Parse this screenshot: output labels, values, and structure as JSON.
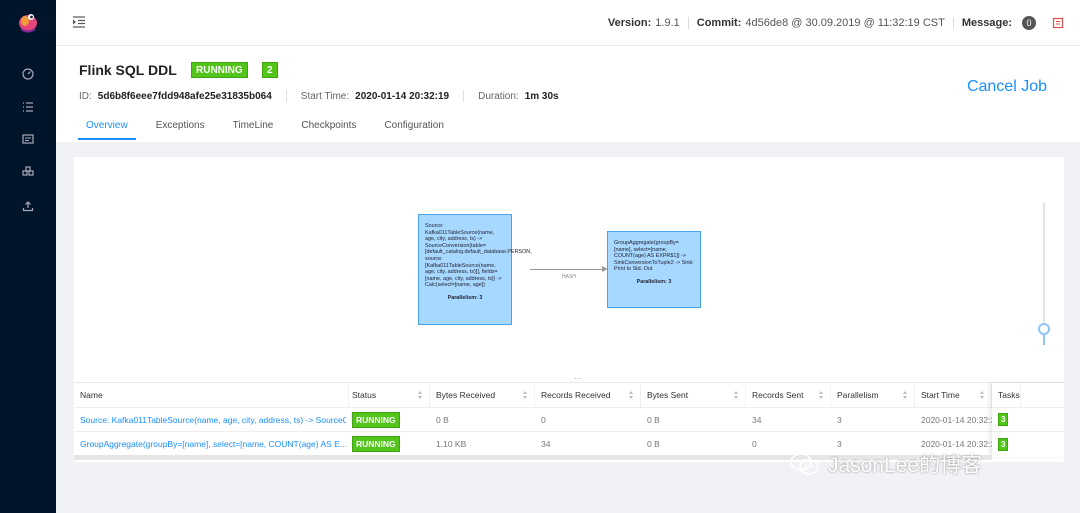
{
  "header": {
    "version_label": "Version:",
    "version_value": "1.9.1",
    "commit_label": "Commit:",
    "commit_value": "4d56de8 @ 30.09.2019 @ 11:32:19 CST",
    "message_label": "Message:",
    "message_count": "0"
  },
  "job": {
    "name": "Flink SQL DDL",
    "status": "RUNNING",
    "task_count": "2",
    "id_label": "ID:",
    "id_value": "5d6b8f6eee7fdd948afe25e31835b064",
    "start_label": "Start Time:",
    "start_value": "2020-01-14 20:32:19",
    "duration_label": "Duration:",
    "duration_value": "1m 30s",
    "cancel_label": "Cancel Job"
  },
  "tabs": [
    "Overview",
    "Exceptions",
    "TimeLine",
    "Checkpoints",
    "Configuration"
  ],
  "graph": {
    "node1_text": "Source: Kafka011TableSource(name, age, city, address, ts) -> SourceConversion(table=[default_catalog.default_database.PERSON, source: [Kafka011TableSource(name, age, city, address, ts)]], fields=[name, age, city, address, ts]) -> Calc(select=[name, age])",
    "node1_parallelism": "Parallelism: 3",
    "node2_text": "GroupAggregate(groupBy=[name], select=[name, COUNT(age) AS EXPR$1]) -> SinkConversionToTuple2 -> Sink: Print to Std. Out",
    "node2_parallelism": "Parallelism: 3",
    "edge_label": "HASH"
  },
  "table": {
    "columns": [
      "Name",
      "Status",
      "Bytes Received",
      "Records Received",
      "Bytes Sent",
      "Records Sent",
      "Parallelism",
      "Start Time",
      "Tasks"
    ],
    "rows": [
      {
        "name": "Source: Kafka011TableSource(name, age, city, address, ts) -> SourceC...",
        "status": "RUNNING",
        "bytes_received": "0 B",
        "records_received": "0",
        "bytes_sent": "0 B",
        "records_sent": "34",
        "parallelism": "3",
        "start_time": "2020-01-14 20:32:3",
        "tasks": "3"
      },
      {
        "name": "GroupAggregate(groupBy=[name], select=[name, COUNT(age) AS E...",
        "status": "RUNNING",
        "bytes_received": "1.10 KB",
        "records_received": "34",
        "bytes_sent": "0 B",
        "records_sent": "0",
        "parallelism": "3",
        "start_time": "2020-01-14 20:32:3",
        "tasks": "3"
      }
    ]
  },
  "watermark": "JasonLee的博客",
  "colors": {
    "accent": "#1890ff",
    "running": "#52c41a",
    "sidebar": "#001529",
    "node_fill": "#a7d8ff"
  }
}
